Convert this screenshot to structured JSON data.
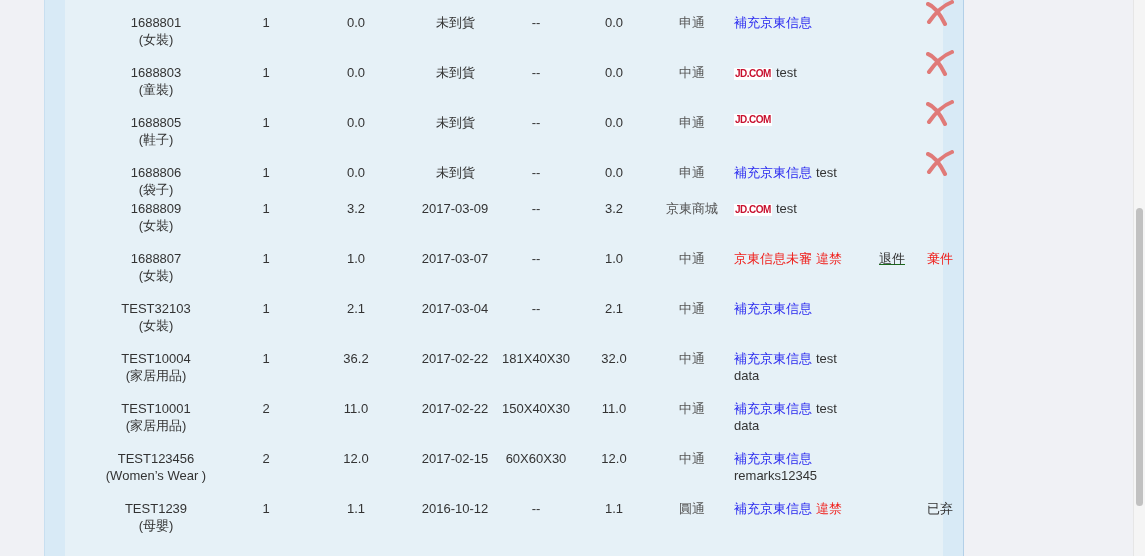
{
  "rows": [
    {
      "id": "1688801",
      "category": "(女裝)",
      "qty": "1",
      "weight": "0.0",
      "date": "未到貨",
      "size": "--",
      "billed_weight": "0.0",
      "carrier": "申通",
      "remarks": [
        {
          "kind": "link",
          "text": "補充京東信息"
        }
      ],
      "actions": [
        {
          "kind": "delete"
        }
      ]
    },
    {
      "id": "1688803",
      "category": "(童裝)",
      "qty": "1",
      "weight": "0.0",
      "date": "未到貨",
      "size": "--",
      "billed_weight": "0.0",
      "carrier": "中通",
      "remarks": [
        {
          "kind": "logo",
          "text": "JD.COM"
        },
        {
          "kind": "text",
          "text": "test"
        }
      ],
      "actions": [
        {
          "kind": "delete"
        }
      ]
    },
    {
      "id": "1688805",
      "category": "(鞋子)",
      "qty": "1",
      "weight": "0.0",
      "date": "未到貨",
      "size": "--",
      "billed_weight": "0.0",
      "carrier": "申通",
      "remarks": [
        {
          "kind": "logo",
          "text": "JD.COM"
        }
      ],
      "actions": [
        {
          "kind": "delete"
        }
      ]
    },
    {
      "id": "1688806",
      "category": "(袋子)",
      "qty": "1",
      "weight": "0.0",
      "date": "未到貨",
      "size": "--",
      "billed_weight": "0.0",
      "carrier": "申通",
      "remarks": [
        {
          "kind": "link",
          "text": "補充京東信息"
        },
        {
          "kind": "text",
          "text": "test"
        }
      ],
      "actions": [
        {
          "kind": "delete"
        }
      ]
    },
    {
      "id": "1688809",
      "category": "(女裝)",
      "qty": "1",
      "weight": "3.2",
      "date": "2017-03-09",
      "size": "--",
      "billed_weight": "3.2",
      "carrier": "京東商城",
      "remarks": [
        {
          "kind": "logo",
          "text": "JD.COM"
        },
        {
          "kind": "text",
          "text": "test"
        }
      ],
      "actions": []
    },
    {
      "id": "1688807",
      "category": "(女裝)",
      "qty": "1",
      "weight": "1.0",
      "date": "2017-03-07",
      "size": "--",
      "billed_weight": "1.0",
      "carrier": "中通",
      "remarks": [
        {
          "kind": "warning",
          "text": "京東信息未審"
        },
        {
          "kind": "warning",
          "text": "違禁"
        }
      ],
      "actions": [
        {
          "kind": "return",
          "text": "退件"
        },
        {
          "kind": "discard",
          "text": "棄件"
        }
      ]
    },
    {
      "id": "TEST32103",
      "category": "(女裝)",
      "qty": "1",
      "weight": "2.1",
      "date": "2017-03-04",
      "size": "--",
      "billed_weight": "2.1",
      "carrier": "中通",
      "remarks": [
        {
          "kind": "link",
          "text": "補充京東信息"
        }
      ],
      "actions": []
    },
    {
      "id": "TEST10004",
      "category": "(家居用品)",
      "qty": "1",
      "weight": "36.2",
      "date": "2017-02-22",
      "size": "181X40X30",
      "billed_weight": "32.0",
      "carrier": "中通",
      "remarks": [
        {
          "kind": "link",
          "text": "補充京東信息"
        },
        {
          "kind": "text",
          "text": "test"
        },
        {
          "kind": "text",
          "text": "data"
        }
      ],
      "actions": []
    },
    {
      "id": "TEST10001",
      "category": "(家居用品)",
      "qty": "2",
      "weight": "11.0",
      "date": "2017-02-22",
      "size": "150X40X30",
      "billed_weight": "11.0",
      "carrier": "中通",
      "remarks": [
        {
          "kind": "link",
          "text": "補充京東信息"
        },
        {
          "kind": "text",
          "text": "test"
        },
        {
          "kind": "text",
          "text": "data"
        }
      ],
      "actions": []
    },
    {
      "id": "TEST123456",
      "category": "(Women’s Wear )",
      "qty": "2",
      "weight": "12.0",
      "date": "2017-02-15",
      "size": "60X60X30",
      "billed_weight": "12.0",
      "carrier": "中通",
      "remarks": [
        {
          "kind": "link",
          "text": "補充京東信息"
        },
        {
          "kind": "text",
          "text": "remarks12345"
        }
      ],
      "actions": []
    },
    {
      "id": "TEST1239",
      "category": "(母嬰)",
      "qty": "1",
      "weight": "1.1",
      "date": "2016-10-12",
      "size": "--",
      "billed_weight": "1.1",
      "carrier": "圓通",
      "remarks": [
        {
          "kind": "link",
          "text": "補充京東信息"
        },
        {
          "kind": "warning",
          "text": "違禁"
        }
      ],
      "actions": [
        {
          "kind": "status",
          "text": "已弃"
        }
      ]
    }
  ]
}
